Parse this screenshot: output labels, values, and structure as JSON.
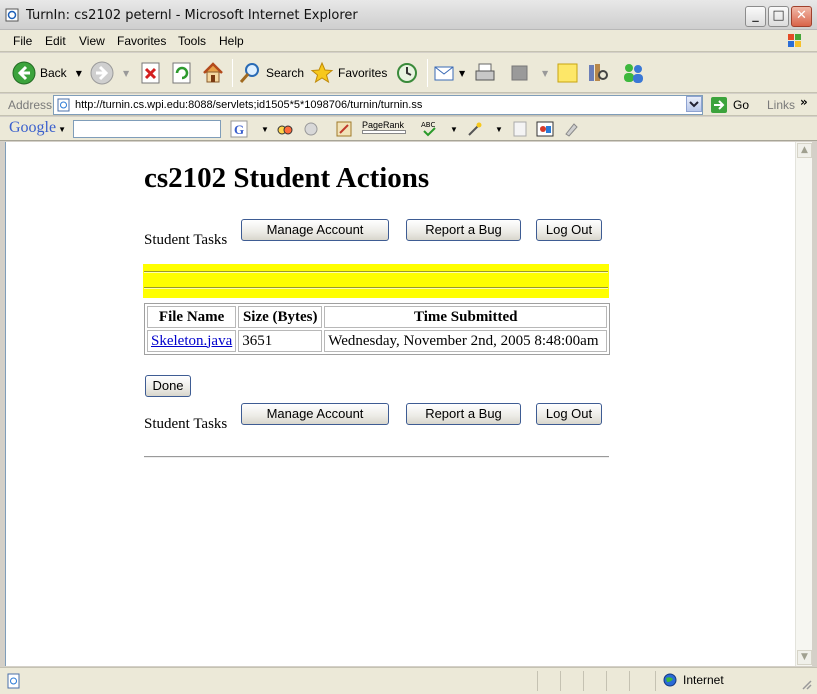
{
  "window": {
    "title": "TurnIn: cs2102 peternl - Microsoft Internet Explorer"
  },
  "menu": [
    "File",
    "Edit",
    "View",
    "Favorites",
    "Tools",
    "Help"
  ],
  "toolbar": {
    "back": "Back",
    "search": "Search",
    "favorites": "Favorites"
  },
  "address": {
    "label": "Address",
    "url": "http://turnin.cs.wpi.edu:8088/servlets;id1505*5*1098706/turnin/turnin.ss",
    "go": "Go",
    "links": "Links"
  },
  "google": {
    "logo": "Google",
    "pagerank": "PageRank",
    "search_value": ""
  },
  "page": {
    "title": "cs2102 Student Actions",
    "student_tasks_label": "Student Tasks",
    "buttons": {
      "manage_account": "Manage Account",
      "report_bug": "Report a Bug",
      "log_out": "Log Out",
      "done": "Done"
    },
    "table": {
      "headers": [
        "File Name",
        "Size (Bytes)",
        "Time Submitted"
      ],
      "rows": [
        {
          "file": "Skeleton.java",
          "size": "3651",
          "time": "Wednesday, November 2nd, 2005 8:48:00am"
        }
      ]
    }
  },
  "status": {
    "zone": "Internet"
  },
  "colors": {
    "highlight": "#ffff00",
    "link": "#0000cc"
  }
}
